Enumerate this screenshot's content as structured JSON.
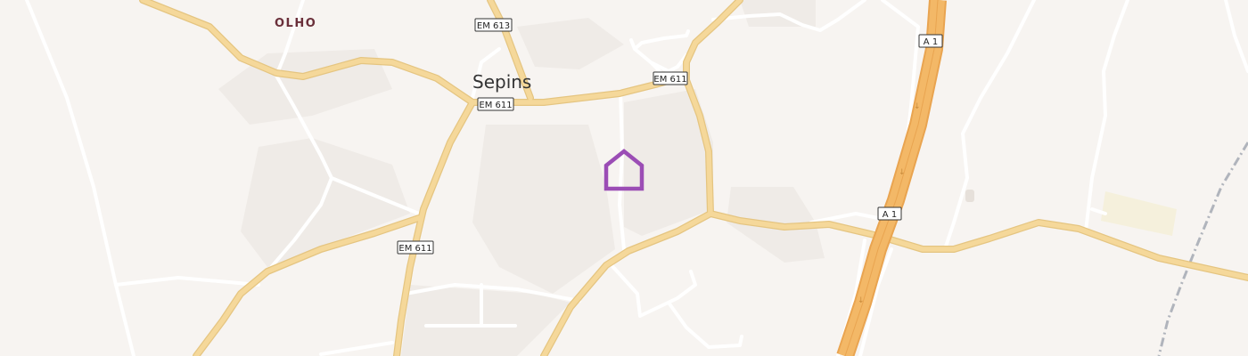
{
  "map": {
    "places": {
      "town": "Sepins",
      "locality": "OLHO"
    },
    "road_shields": {
      "em613": "EM 613",
      "em611_a": "EM 611",
      "em611_b": "EM 611",
      "em611_c": "EM 611",
      "a1_top": "A 1",
      "a1_mid": "A 1"
    },
    "marker": {
      "icon": "house-icon",
      "color": "#9b4db5"
    },
    "colors": {
      "background": "#f7f4f1",
      "landuse": "#efebe7",
      "minor_road": "#ffffff",
      "main_road": "#f5d89a",
      "motorway": "#f3b867",
      "railway": "#b0b4bc"
    }
  }
}
